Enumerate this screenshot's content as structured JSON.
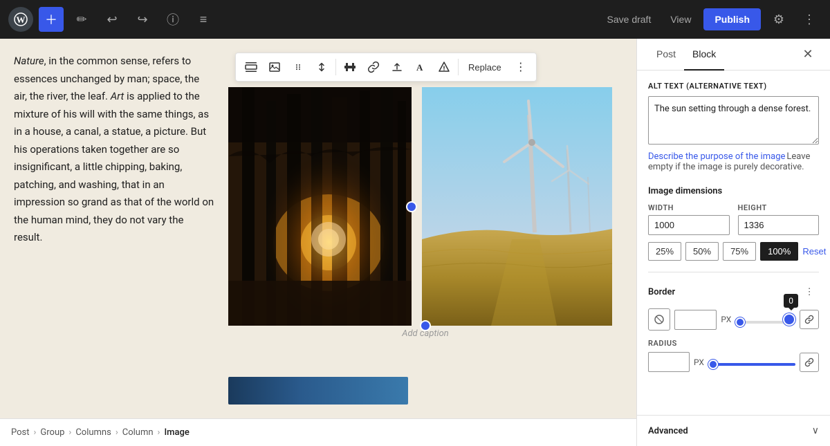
{
  "topbar": {
    "wp_logo": "W",
    "save_draft_label": "Save draft",
    "view_label": "View",
    "publish_label": "Publish"
  },
  "editor": {
    "text_content": "Nature, in the common sense, refers to essences unchanged by man; space, the air, the river, the leaf. Art is applied to the mixture of his will with the same things, as in a house, a canal, a statue, a picture. But his operations taken together are so insignificant, a little chipping, baking, patching, and washing, that in an impression so grand as that of the world on the human mind, they do not vary the result.",
    "caption_placeholder": "Add caption"
  },
  "toolbar": {
    "replace_label": "Replace"
  },
  "panel": {
    "post_tab": "Post",
    "block_tab": "Block",
    "alt_text_label": "ALT TEXT (ALTERNATIVE TEXT)",
    "alt_text_value": "The sun setting through a dense forest.",
    "describe_link": "Describe the purpose of the image",
    "describe_note": "Leave empty if the image is purely decorative.",
    "dimensions_label": "Image dimensions",
    "width_label": "WIDTH",
    "height_label": "HEIGHT",
    "width_value": "1000",
    "height_value": "1336",
    "pct_25": "25%",
    "pct_50": "50%",
    "pct_75": "75%",
    "pct_100": "100%",
    "reset_label": "Reset",
    "border_label": "Border",
    "border_px": "PX",
    "radius_label": "RADIUS",
    "radius_px": "PX",
    "tooltip_value": "0",
    "advanced_label": "Advanced"
  },
  "breadcrumb": {
    "items": [
      "Post",
      "Group",
      "Columns",
      "Column",
      "Image"
    ]
  }
}
